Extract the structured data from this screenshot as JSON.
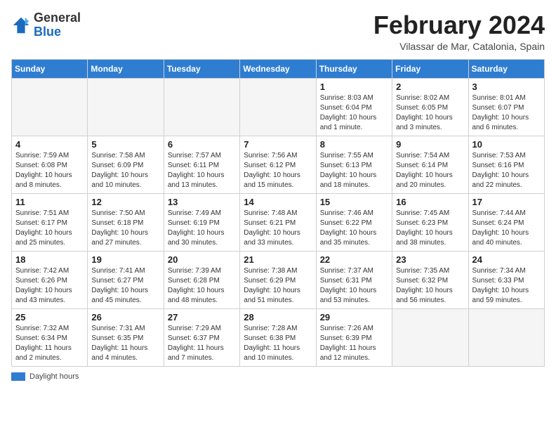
{
  "logo": {
    "general": "General",
    "blue": "Blue"
  },
  "title": "February 2024",
  "location": "Vilassar de Mar, Catalonia, Spain",
  "headers": [
    "Sunday",
    "Monday",
    "Tuesday",
    "Wednesday",
    "Thursday",
    "Friday",
    "Saturday"
  ],
  "weeks": [
    [
      {
        "num": "",
        "info": "",
        "empty": true
      },
      {
        "num": "",
        "info": "",
        "empty": true
      },
      {
        "num": "",
        "info": "",
        "empty": true
      },
      {
        "num": "",
        "info": "",
        "empty": true
      },
      {
        "num": "1",
        "info": "Sunrise: 8:03 AM\nSunset: 6:04 PM\nDaylight: 10 hours and 1 minute."
      },
      {
        "num": "2",
        "info": "Sunrise: 8:02 AM\nSunset: 6:05 PM\nDaylight: 10 hours and 3 minutes."
      },
      {
        "num": "3",
        "info": "Sunrise: 8:01 AM\nSunset: 6:07 PM\nDaylight: 10 hours and 6 minutes."
      }
    ],
    [
      {
        "num": "4",
        "info": "Sunrise: 7:59 AM\nSunset: 6:08 PM\nDaylight: 10 hours and 8 minutes."
      },
      {
        "num": "5",
        "info": "Sunrise: 7:58 AM\nSunset: 6:09 PM\nDaylight: 10 hours and 10 minutes."
      },
      {
        "num": "6",
        "info": "Sunrise: 7:57 AM\nSunset: 6:11 PM\nDaylight: 10 hours and 13 minutes."
      },
      {
        "num": "7",
        "info": "Sunrise: 7:56 AM\nSunset: 6:12 PM\nDaylight: 10 hours and 15 minutes."
      },
      {
        "num": "8",
        "info": "Sunrise: 7:55 AM\nSunset: 6:13 PM\nDaylight: 10 hours and 18 minutes."
      },
      {
        "num": "9",
        "info": "Sunrise: 7:54 AM\nSunset: 6:14 PM\nDaylight: 10 hours and 20 minutes."
      },
      {
        "num": "10",
        "info": "Sunrise: 7:53 AM\nSunset: 6:16 PM\nDaylight: 10 hours and 22 minutes."
      }
    ],
    [
      {
        "num": "11",
        "info": "Sunrise: 7:51 AM\nSunset: 6:17 PM\nDaylight: 10 hours and 25 minutes."
      },
      {
        "num": "12",
        "info": "Sunrise: 7:50 AM\nSunset: 6:18 PM\nDaylight: 10 hours and 27 minutes."
      },
      {
        "num": "13",
        "info": "Sunrise: 7:49 AM\nSunset: 6:19 PM\nDaylight: 10 hours and 30 minutes."
      },
      {
        "num": "14",
        "info": "Sunrise: 7:48 AM\nSunset: 6:21 PM\nDaylight: 10 hours and 33 minutes."
      },
      {
        "num": "15",
        "info": "Sunrise: 7:46 AM\nSunset: 6:22 PM\nDaylight: 10 hours and 35 minutes."
      },
      {
        "num": "16",
        "info": "Sunrise: 7:45 AM\nSunset: 6:23 PM\nDaylight: 10 hours and 38 minutes."
      },
      {
        "num": "17",
        "info": "Sunrise: 7:44 AM\nSunset: 6:24 PM\nDaylight: 10 hours and 40 minutes."
      }
    ],
    [
      {
        "num": "18",
        "info": "Sunrise: 7:42 AM\nSunset: 6:26 PM\nDaylight: 10 hours and 43 minutes."
      },
      {
        "num": "19",
        "info": "Sunrise: 7:41 AM\nSunset: 6:27 PM\nDaylight: 10 hours and 45 minutes."
      },
      {
        "num": "20",
        "info": "Sunrise: 7:39 AM\nSunset: 6:28 PM\nDaylight: 10 hours and 48 minutes."
      },
      {
        "num": "21",
        "info": "Sunrise: 7:38 AM\nSunset: 6:29 PM\nDaylight: 10 hours and 51 minutes."
      },
      {
        "num": "22",
        "info": "Sunrise: 7:37 AM\nSunset: 6:31 PM\nDaylight: 10 hours and 53 minutes."
      },
      {
        "num": "23",
        "info": "Sunrise: 7:35 AM\nSunset: 6:32 PM\nDaylight: 10 hours and 56 minutes."
      },
      {
        "num": "24",
        "info": "Sunrise: 7:34 AM\nSunset: 6:33 PM\nDaylight: 10 hours and 59 minutes."
      }
    ],
    [
      {
        "num": "25",
        "info": "Sunrise: 7:32 AM\nSunset: 6:34 PM\nDaylight: 11 hours and 2 minutes."
      },
      {
        "num": "26",
        "info": "Sunrise: 7:31 AM\nSunset: 6:35 PM\nDaylight: 11 hours and 4 minutes."
      },
      {
        "num": "27",
        "info": "Sunrise: 7:29 AM\nSunset: 6:37 PM\nDaylight: 11 hours and 7 minutes."
      },
      {
        "num": "28",
        "info": "Sunrise: 7:28 AM\nSunset: 6:38 PM\nDaylight: 11 hours and 10 minutes."
      },
      {
        "num": "29",
        "info": "Sunrise: 7:26 AM\nSunset: 6:39 PM\nDaylight: 11 hours and 12 minutes."
      },
      {
        "num": "",
        "info": "",
        "empty": true
      },
      {
        "num": "",
        "info": "",
        "empty": true
      }
    ]
  ],
  "legend": {
    "box_color": "#2e7dd1",
    "label": "Daylight hours"
  }
}
